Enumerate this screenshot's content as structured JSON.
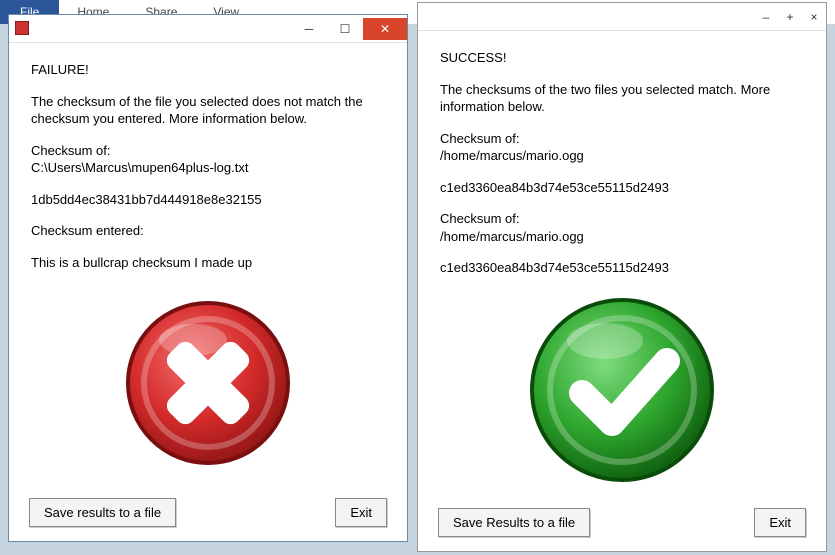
{
  "ribbon": {
    "file": "File",
    "tabs": [
      "Home",
      "Share",
      "View"
    ]
  },
  "failure": {
    "heading": "FAILURE!",
    "msg": "The checksum of the file you selected does not match the checksum you entered.  More information below.",
    "label1": "Checksum of:",
    "path1": "C:\\Users\\Marcus\\mupen64plus-log.txt",
    "hash1": "1db5dd4ec38431bb7d444918e8e32155",
    "label2": "Checksum entered:",
    "hash2": "This is a bullcrap checksum I made up",
    "save": "Save results to a file",
    "exit": "Exit"
  },
  "success": {
    "heading": "SUCCESS!",
    "msg": "The checksums of the two files you selected match.  More information below.",
    "label1": "Checksum of:",
    "path1": "/home/marcus/mario.ogg",
    "hash1": "c1ed3360ea84b3d74e53ce55115d2493",
    "label2": "Checksum of:",
    "path2": "/home/marcus/mario.ogg",
    "hash2": "c1ed3360ea84b3d74e53ce55115d2493",
    "save": "Save Results to a file",
    "exit": "Exit"
  }
}
